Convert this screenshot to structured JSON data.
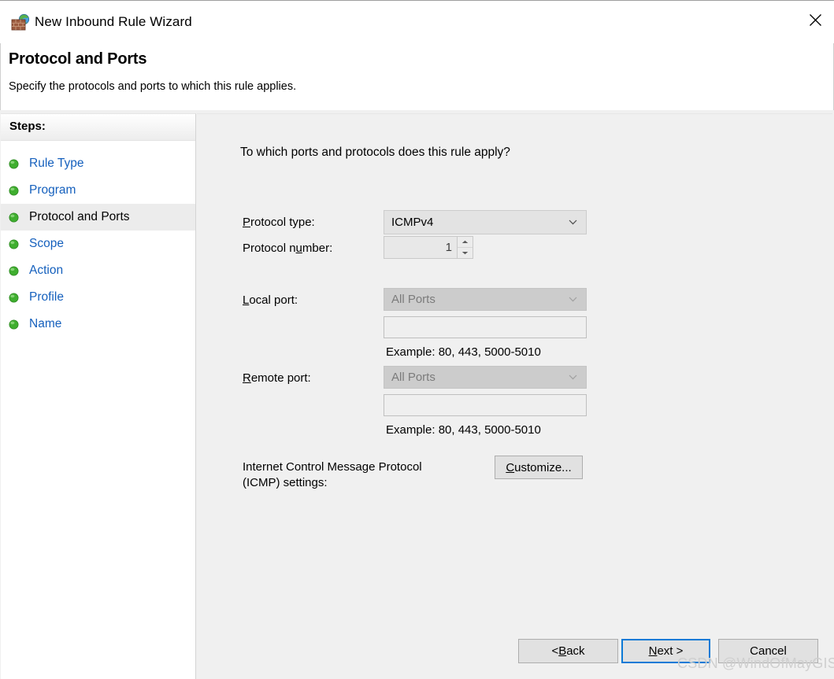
{
  "window": {
    "title": "New Inbound Rule Wizard",
    "app_icon": "firewall-brick-globe-icon",
    "close_label": "✕"
  },
  "header": {
    "title": "Protocol and Ports",
    "subtitle": "Specify the protocols and ports to which this rule applies."
  },
  "sidebar": {
    "heading": "Steps:",
    "items": [
      {
        "label": "Rule Type",
        "selected": false
      },
      {
        "label": "Program",
        "selected": false
      },
      {
        "label": "Protocol and Ports",
        "selected": true
      },
      {
        "label": "Scope",
        "selected": false
      },
      {
        "label": "Action",
        "selected": false
      },
      {
        "label": "Profile",
        "selected": false
      },
      {
        "label": "Name",
        "selected": false
      }
    ]
  },
  "main": {
    "question": "To which ports and protocols does this rule apply?",
    "protocol_type": {
      "label_prefix": "",
      "label_accel": "P",
      "label_suffix": "rotocol type:",
      "value": "ICMPv4",
      "enabled": true
    },
    "protocol_number": {
      "label_prefix": "Protocol n",
      "label_accel": "u",
      "label_suffix": "mber:",
      "value": "1"
    },
    "local_port": {
      "label_prefix": "",
      "label_accel": "L",
      "label_suffix": "ocal port:",
      "value": "All Ports",
      "enabled": false,
      "text_value": "",
      "hint": "Example: 80, 443, 5000-5010"
    },
    "remote_port": {
      "label_prefix": "",
      "label_accel": "R",
      "label_suffix": "emote port:",
      "value": "All Ports",
      "enabled": false,
      "text_value": "",
      "hint": "Example: 80, 443, 5000-5010"
    },
    "icmp_settings": {
      "label": "Internet Control Message Protocol\n(ICMP) settings:",
      "button_prefix": "",
      "button_accel": "C",
      "button_suffix": "ustomize..."
    }
  },
  "footer": {
    "back": {
      "prefix": "< ",
      "accel": "B",
      "suffix": "ack"
    },
    "next": {
      "prefix": "",
      "accel": "N",
      "suffix": "ext >"
    },
    "cancel": {
      "prefix": "Cancel",
      "accel": "",
      "suffix": ""
    }
  },
  "watermark": "CSDN @WindOfMayGIS",
  "colors": {
    "accent_link": "#1560bd",
    "default_button_border": "#0d7ad6",
    "content_bg": "#f0f0f0",
    "selected_step_bg": "#ececec"
  }
}
